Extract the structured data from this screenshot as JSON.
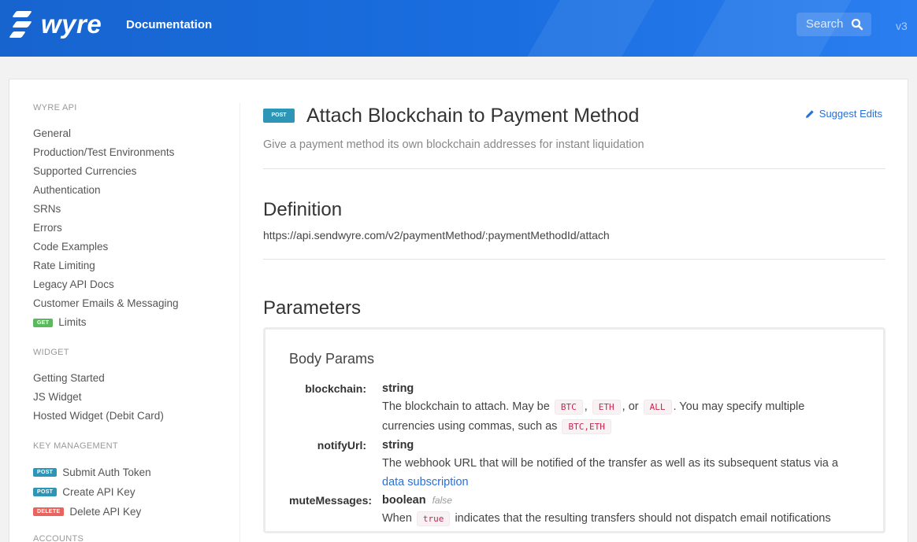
{
  "header": {
    "logo_text": "wyre",
    "section_label": "Documentation",
    "search_placeholder": "Search",
    "version": "v3"
  },
  "sidebar": {
    "sections": [
      {
        "heading": "WYRE API",
        "items": [
          {
            "label": "General"
          },
          {
            "label": "Production/Test Environments"
          },
          {
            "label": "Supported Currencies"
          },
          {
            "label": "Authentication"
          },
          {
            "label": "SRNs"
          },
          {
            "label": "Errors"
          },
          {
            "label": "Code Examples"
          },
          {
            "label": "Rate Limiting"
          },
          {
            "label": "Legacy API Docs"
          },
          {
            "label": "Customer Emails & Messaging"
          },
          {
            "label": "Limits",
            "badge": "GET"
          }
        ]
      },
      {
        "heading": "WIDGET",
        "items": [
          {
            "label": "Getting Started"
          },
          {
            "label": "JS Widget"
          },
          {
            "label": "Hosted Widget (Debit Card)"
          }
        ]
      },
      {
        "heading": "KEY MANAGEMENT",
        "items": [
          {
            "label": "Submit Auth Token",
            "badge": "POST"
          },
          {
            "label": "Create API Key",
            "badge": "POST"
          },
          {
            "label": "Delete API Key",
            "badge": "DELETE"
          }
        ]
      },
      {
        "heading": "ACCOUNTS",
        "items": []
      }
    ]
  },
  "main": {
    "method": "POST",
    "title": "Attach Blockchain to Payment Method",
    "suggest_edits": "Suggest Edits",
    "subtitle": "Give a payment method its own blockchain addresses for instant liquidation",
    "definition_heading": "Definition",
    "definition_url": "https://api.sendwyre.com/v2/paymentMethod/:paymentMethodId/attach",
    "parameters_heading": "Parameters",
    "body_params_heading": "Body Params",
    "params": {
      "blockchain": {
        "name": "blockchain:",
        "type": "string",
        "desc_1": "The blockchain to attach. May be",
        "code_btc": "BTC",
        "sep_1": ",",
        "code_eth": "ETH",
        "sep_2": ", or",
        "code_all": "ALL",
        "desc_2": ". You may specify multiple currencies using commas, such as",
        "code_multi": "BTC,ETH"
      },
      "notifyUrl": {
        "name": "notifyUrl:",
        "type": "string",
        "desc": "The webhook URL that will be notified of the transfer as well as its subsequent status via a",
        "link": "data subscription"
      },
      "muteMessages": {
        "name": "muteMessages:",
        "type": "boolean",
        "default": "false",
        "desc_1": "When",
        "code_true": "true",
        "desc_2": "indicates that the resulting transfers should not dispatch email notifications"
      }
    }
  },
  "colors": {
    "header_blue": "#1a6ee0",
    "post_badge": "#2d95b6",
    "get_badge": "#5cb85c",
    "delete_badge": "#e8645e",
    "link": "#2a6fd6"
  }
}
